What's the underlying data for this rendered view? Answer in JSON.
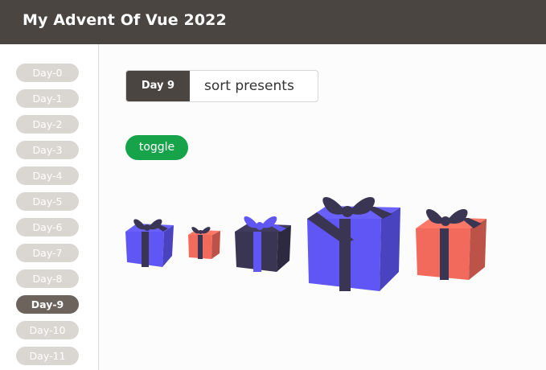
{
  "app": {
    "title": "My Advent Of Vue 2022"
  },
  "sidebar": {
    "items": [
      {
        "label": "Day-0"
      },
      {
        "label": "Day-1"
      },
      {
        "label": "Day-2"
      },
      {
        "label": "Day-3"
      },
      {
        "label": "Day-4"
      },
      {
        "label": "Day-5"
      },
      {
        "label": "Day-6"
      },
      {
        "label": "Day-7"
      },
      {
        "label": "Day-8"
      },
      {
        "label": "Day-9",
        "active": true
      },
      {
        "label": "Day-10"
      },
      {
        "label": "Day-11"
      }
    ]
  },
  "main": {
    "day_badge": "Day 9",
    "challenge_title": "sort presents",
    "toggle_label": "toggle",
    "presents": [
      {
        "icon": "gift-icon",
        "box_color": "#5f56f5",
        "ribbon_color": "#3a3553"
      },
      {
        "icon": "gift-icon",
        "box_color": "#f26a5c",
        "ribbon_color": "#3a3553"
      },
      {
        "icon": "gift-icon",
        "box_color": "#3a3553",
        "ribbon_color": "#5f56f5"
      },
      {
        "icon": "gift-icon",
        "box_color": "#5f56f5",
        "ribbon_color": "#3a3553"
      },
      {
        "icon": "gift-icon",
        "box_color": "#f26a5c",
        "ribbon_color": "#3a3553"
      }
    ]
  },
  "colors": {
    "topbar": "#4a4541",
    "pill_inactive": "#dad6d2",
    "pill_active": "#6c635d",
    "toggle": "#17a34a"
  }
}
